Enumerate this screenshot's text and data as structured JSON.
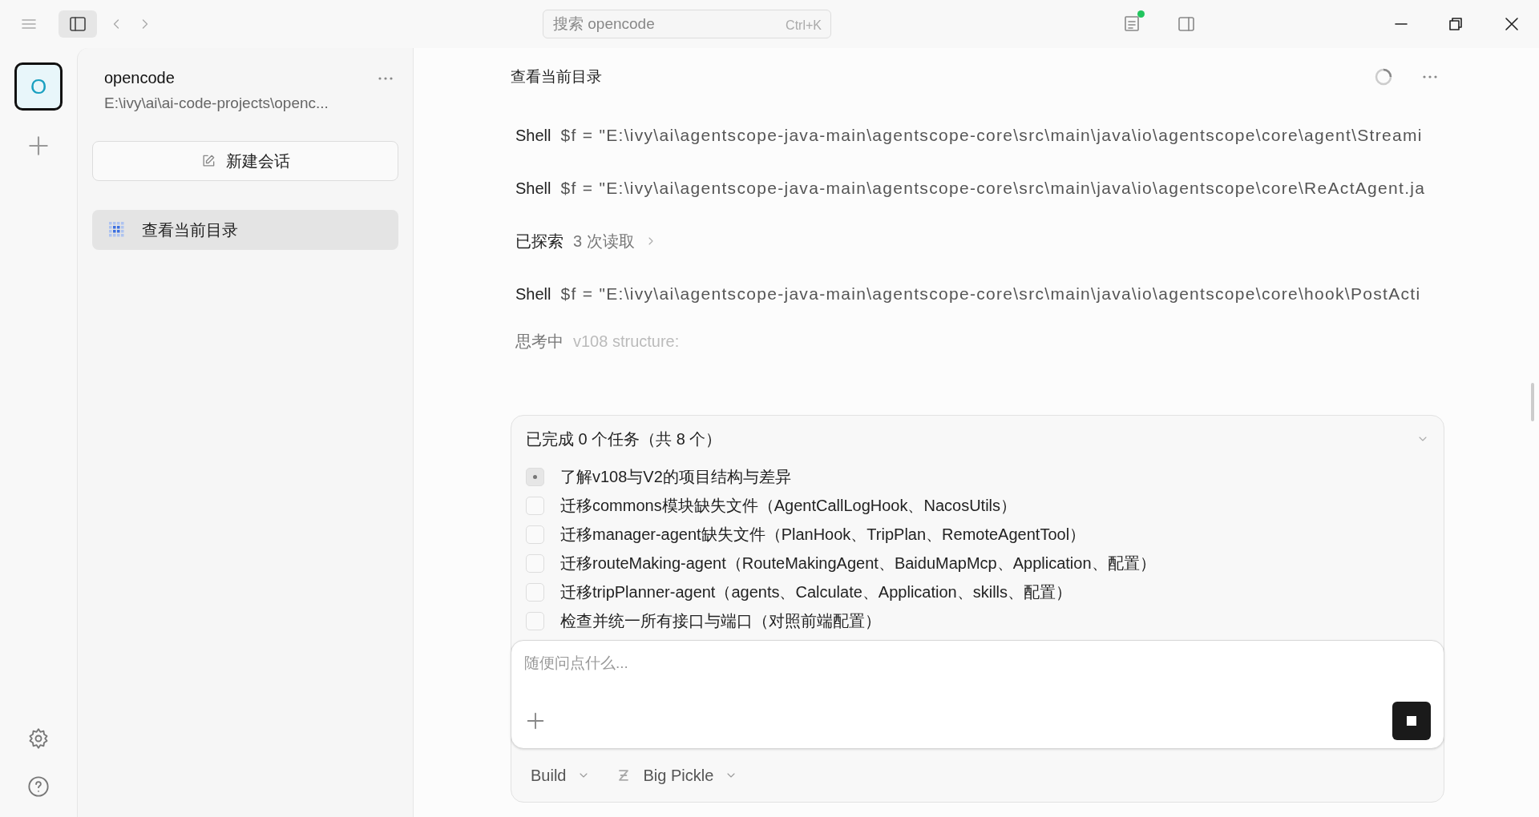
{
  "titlebar": {
    "search": {
      "placeholder": "搜索 opencode",
      "shortcut": "Ctrl+K"
    }
  },
  "rail": {
    "projects": [
      {
        "letter": "O",
        "selected": true
      }
    ]
  },
  "sidebar": {
    "project_name": "opencode",
    "project_path": "E:\\ivy\\ai\\ai-code-projects\\openc...",
    "new_session": "新建会话",
    "sessions": [
      {
        "title": "查看当前目录",
        "selected": true
      }
    ]
  },
  "chat": {
    "title": "查看当前目录",
    "steps": [
      {
        "kind": "tool",
        "label": "Shell",
        "text": "$f = \"E:\\ivy\\ai\\agentscope-java-main\\agentscope-core\\src\\main\\java\\io\\agentscope\\core\\agent\\Streami"
      },
      {
        "kind": "tool",
        "label": "Shell",
        "text": "$f = \"E:\\ivy\\ai\\agentscope-java-main\\agentscope-core\\src\\main\\java\\io\\agentscope\\core\\ReActAgent.ja"
      },
      {
        "kind": "explored",
        "label": "已探索",
        "text": "3 次读取"
      },
      {
        "kind": "tool",
        "label": "Shell",
        "text": "$f = \"E:\\ivy\\ai\\agentscope-java-main\\agentscope-core\\src\\main\\java\\io\\agentscope\\core\\hook\\PostActi"
      },
      {
        "kind": "thinking",
        "label": "思考中",
        "text": "v108 structure:"
      }
    ]
  },
  "todos": {
    "summary": "已完成 0 个任务（共 8 个）",
    "expanded": true,
    "items": [
      {
        "text": "了解v108与V2的项目结构与差异",
        "in_progress": true
      },
      {
        "text": "迁移commons模块缺失文件（AgentCallLogHook、NacosUtils）",
        "in_progress": false
      },
      {
        "text": "迁移manager-agent缺失文件（PlanHook、TripPlan、RemoteAgentTool）",
        "in_progress": false
      },
      {
        "text": "迁移routeMaking-agent（RouteMakingAgent、BaiduMapMcp、Application、配置）",
        "in_progress": false
      },
      {
        "text": "迁移tripPlanner-agent（agents、Calculate、Application、skills、配置）",
        "in_progress": false
      },
      {
        "text": "检查并统一所有接口与端口（对照前端配置）",
        "in_progress": false
      }
    ]
  },
  "composer": {
    "placeholder": "随便问点什么...",
    "agent": "Build",
    "model": "Big Pickle"
  }
}
